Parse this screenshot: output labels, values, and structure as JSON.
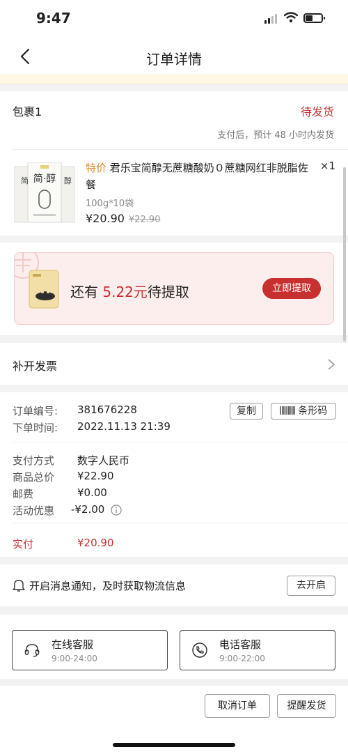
{
  "status_bar": {
    "time": "9:47"
  },
  "nav": {
    "title": "订单详情"
  },
  "package": {
    "title": "包裹1",
    "status": "待发货",
    "note": "支付后，预计 48 小时内发货",
    "product": {
      "tag": "特价",
      "title": "君乐宝简醇无蔗糖酸奶０蔗糖网红非脱脂佐餐",
      "quantity": "×1",
      "spec": "100g*10袋",
      "price": "¥20.90",
      "original_price": "¥22.90",
      "image_text": "简·醇"
    }
  },
  "promo": {
    "prefix": "还有 ",
    "amount": "5.22元",
    "suffix": "待提取",
    "button": "立即提取"
  },
  "invoice": {
    "label": "补开发票"
  },
  "order_info": {
    "order_no_label": "订单编号:",
    "order_no": "381676228",
    "copy_button": "复制",
    "barcode_button": "条形码",
    "time_label": "下单时间:",
    "time": "2022.11.13 21:39",
    "payment_label": "支付方式",
    "payment": "数字人民币",
    "total_label": "商品总价",
    "total": "¥22.90",
    "shipping_label": "邮费",
    "shipping": "¥0.00",
    "discount_label": "活动优惠",
    "discount": "-¥2.00",
    "paid_label": "实付",
    "paid": "¥20.90"
  },
  "notify": {
    "text": "开启消息通知，及时获取物流信息",
    "button": "去开启"
  },
  "service": {
    "online": {
      "name": "在线客服",
      "hours": "9:00-24:00"
    },
    "phone": {
      "name": "电话客服",
      "hours": "9:00-22:00"
    }
  },
  "actions": {
    "cancel": "取消订单",
    "remind": "提醒发货"
  },
  "colors": {
    "accent": "#c8302f",
    "tag": "#e3892b",
    "banner": "#fdf7e4"
  }
}
